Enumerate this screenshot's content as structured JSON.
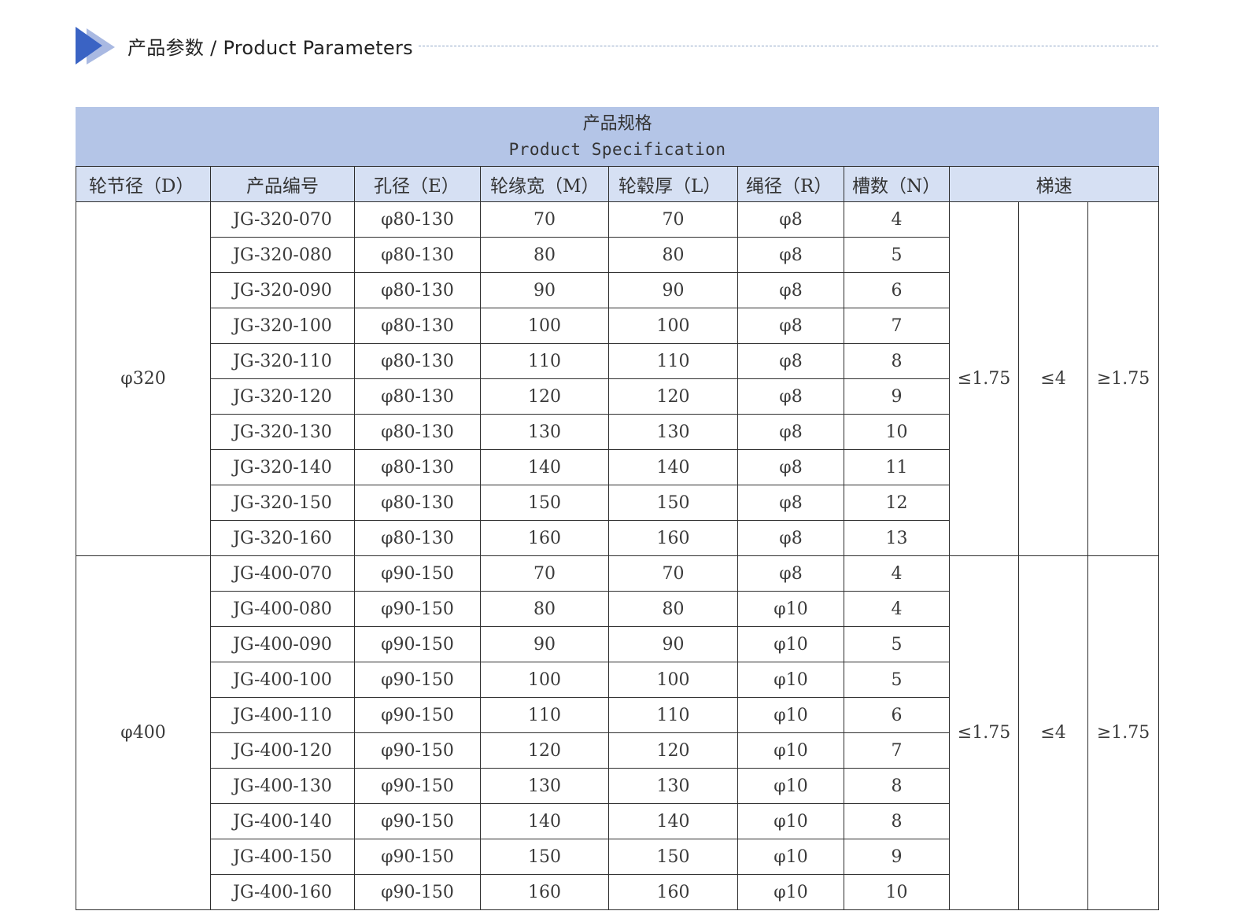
{
  "header": {
    "title": "产品参数 / Product Parameters",
    "accent": "#3a63c4"
  },
  "table": {
    "caption_cn": "产品规格",
    "caption_en": "Product Specification",
    "headers": [
      "轮节径（D）",
      "产品编号",
      "孔径（E）",
      "轮缘宽（M）",
      "轮毂厚（L）",
      "绳径（R）",
      "槽数（N）",
      "梯速"
    ],
    "groups": [
      {
        "diameter": "φ320",
        "speed": [
          "≤1.75",
          "≤4",
          "≥1.75"
        ],
        "rows": [
          [
            "JG-320-070",
            "φ80-130",
            "70",
            "70",
            "φ8",
            "4"
          ],
          [
            "JG-320-080",
            "φ80-130",
            "80",
            "80",
            "φ8",
            "5"
          ],
          [
            "JG-320-090",
            "φ80-130",
            "90",
            "90",
            "φ8",
            "6"
          ],
          [
            "JG-320-100",
            "φ80-130",
            "100",
            "100",
            "φ8",
            "7"
          ],
          [
            "JG-320-110",
            "φ80-130",
            "110",
            "110",
            "φ8",
            "8"
          ],
          [
            "JG-320-120",
            "φ80-130",
            "120",
            "120",
            "φ8",
            "9"
          ],
          [
            "JG-320-130",
            "φ80-130",
            "130",
            "130",
            "φ8",
            "10"
          ],
          [
            "JG-320-140",
            "φ80-130",
            "140",
            "140",
            "φ8",
            "11"
          ],
          [
            "JG-320-150",
            "φ80-130",
            "150",
            "150",
            "φ8",
            "12"
          ],
          [
            "JG-320-160",
            "φ80-130",
            "160",
            "160",
            "φ8",
            "13"
          ]
        ]
      },
      {
        "diameter": "φ400",
        "speed": [
          "≤1.75",
          "≤4",
          "≥1.75"
        ],
        "rows": [
          [
            "JG-400-070",
            "φ90-150",
            "70",
            "70",
            "φ8",
            "4"
          ],
          [
            "JG-400-080",
            "φ90-150",
            "80",
            "80",
            "φ10",
            "4"
          ],
          [
            "JG-400-090",
            "φ90-150",
            "90",
            "90",
            "φ10",
            "5"
          ],
          [
            "JG-400-100",
            "φ90-150",
            "100",
            "100",
            "φ10",
            "5"
          ],
          [
            "JG-400-110",
            "φ90-150",
            "110",
            "110",
            "φ10",
            "6"
          ],
          [
            "JG-400-120",
            "φ90-150",
            "120",
            "120",
            "φ10",
            "7"
          ],
          [
            "JG-400-130",
            "φ90-150",
            "130",
            "130",
            "φ10",
            "8"
          ],
          [
            "JG-400-140",
            "φ90-150",
            "140",
            "140",
            "φ10",
            "8"
          ],
          [
            "JG-400-150",
            "φ90-150",
            "150",
            "150",
            "φ10",
            "9"
          ],
          [
            "JG-400-160",
            "φ90-150",
            "160",
            "160",
            "φ10",
            "10"
          ]
        ]
      }
    ]
  }
}
